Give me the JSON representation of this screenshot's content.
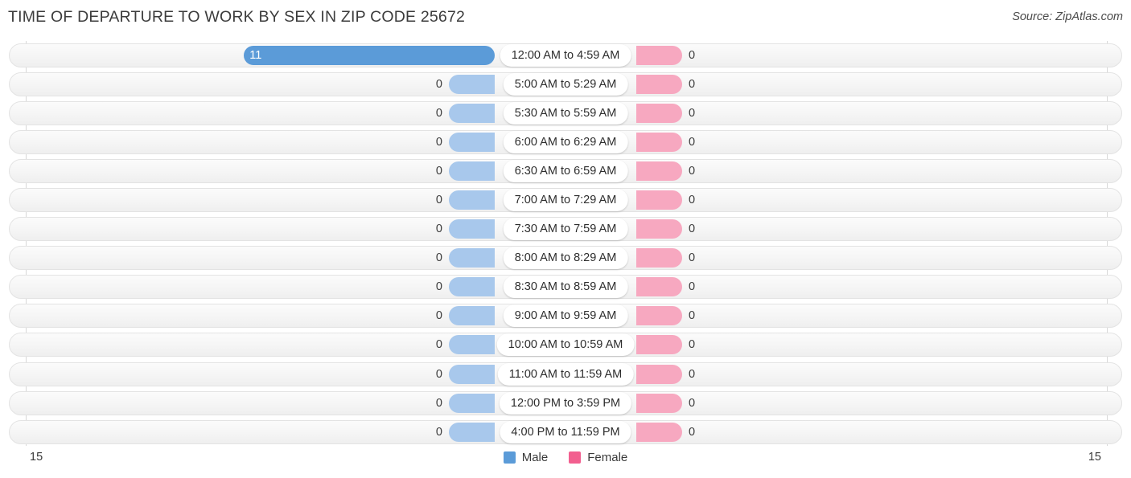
{
  "header": {
    "title": "TIME OF DEPARTURE TO WORK BY SEX IN ZIP CODE 25672",
    "source": "Source: ZipAtlas.com"
  },
  "legend": {
    "male_label": "Male",
    "female_label": "Female",
    "male_color": "#5b9bd8",
    "female_color": "#f25f8f",
    "male_zero_color": "#a8c8ec",
    "female_zero_color": "#f7a8c0"
  },
  "axis": {
    "left_max_label": "15",
    "right_max_label": "15",
    "max_value": 15
  },
  "chart_data": {
    "type": "bar",
    "title": "TIME OF DEPARTURE TO WORK BY SEX IN ZIP CODE 25672",
    "subtitle": "Source: ZipAtlas.com",
    "orientation": "horizontal-diverging",
    "xlabel": "",
    "ylabel": "",
    "xlim": [
      15,
      15
    ],
    "grid": true,
    "legend_position": "bottom-center",
    "categories": [
      "12:00 AM to 4:59 AM",
      "5:00 AM to 5:29 AM",
      "5:30 AM to 5:59 AM",
      "6:00 AM to 6:29 AM",
      "6:30 AM to 6:59 AM",
      "7:00 AM to 7:29 AM",
      "7:30 AM to 7:59 AM",
      "8:00 AM to 8:29 AM",
      "8:30 AM to 8:59 AM",
      "9:00 AM to 9:59 AM",
      "10:00 AM to 10:59 AM",
      "11:00 AM to 11:59 AM",
      "12:00 PM to 3:59 PM",
      "4:00 PM to 11:59 PM"
    ],
    "series": [
      {
        "name": "Male",
        "values": [
          11,
          0,
          0,
          0,
          0,
          0,
          0,
          0,
          0,
          0,
          0,
          0,
          0,
          0
        ],
        "labels": [
          "11",
          "0",
          "0",
          "0",
          "0",
          "0",
          "0",
          "0",
          "0",
          "0",
          "0",
          "0",
          "0",
          "0"
        ]
      },
      {
        "name": "Female",
        "values": [
          0,
          0,
          0,
          0,
          0,
          0,
          0,
          0,
          0,
          0,
          0,
          0,
          0,
          0
        ],
        "labels": [
          "0",
          "0",
          "0",
          "0",
          "0",
          "0",
          "0",
          "0",
          "0",
          "0",
          "0",
          "0",
          "0",
          "0"
        ]
      }
    ]
  }
}
